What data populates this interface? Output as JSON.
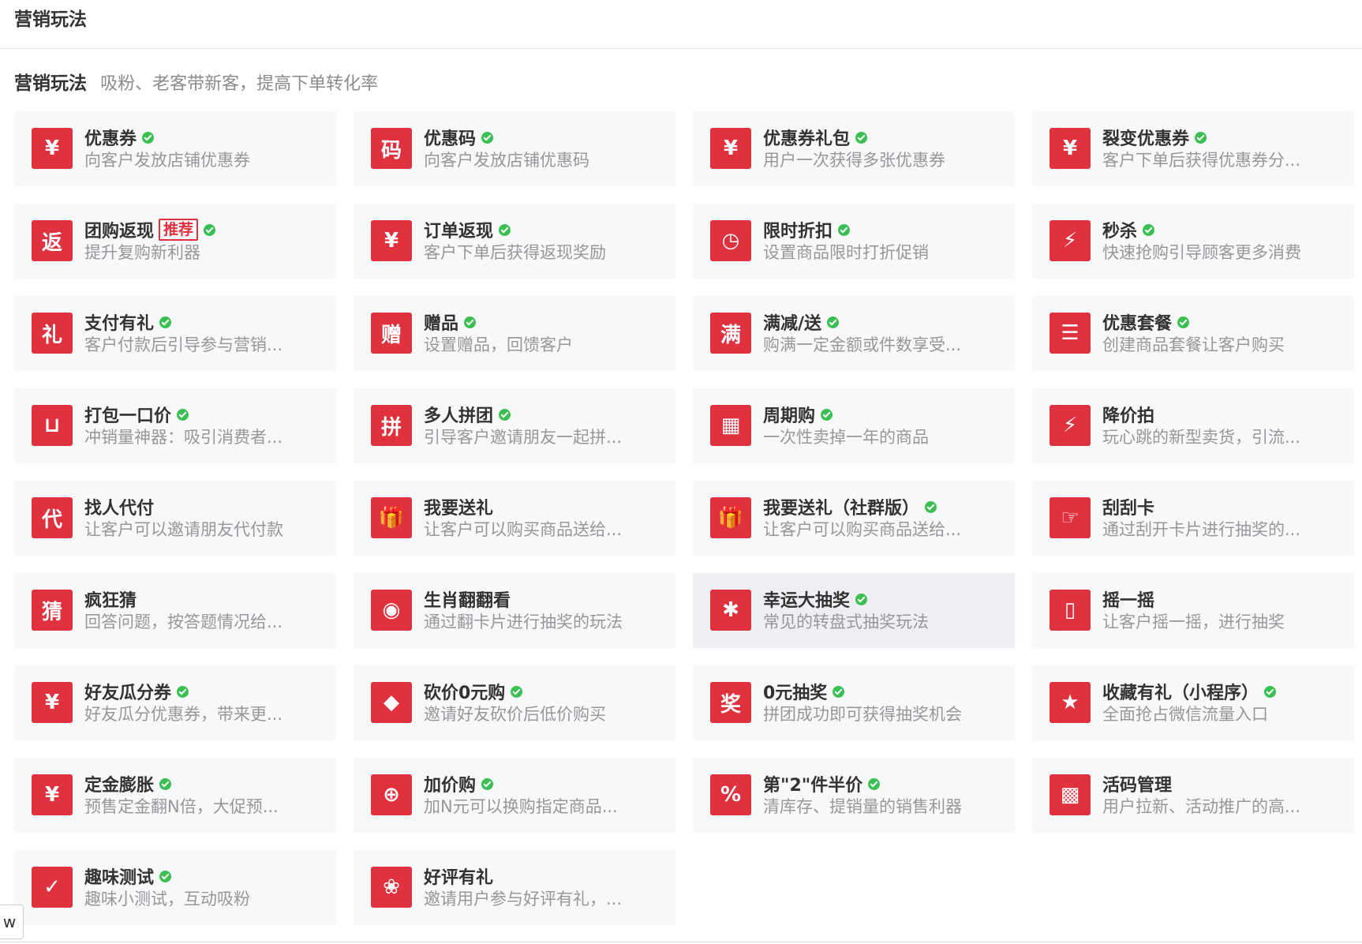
{
  "header": {
    "title": "营销玩法"
  },
  "section": {
    "title": "营销玩法",
    "desc": "吸粉、老客带新客，提高下单转化率"
  },
  "corner": {
    "label": "w"
  },
  "tools": [
    {
      "name": "优惠券",
      "desc": "向客户发放店铺优惠券",
      "icon": "coupon-icon",
      "glyph": "¥",
      "check": true
    },
    {
      "name": "优惠码",
      "desc": "向客户发放店铺优惠码",
      "icon": "code-icon",
      "glyph": "码",
      "check": true
    },
    {
      "name": "优惠券礼包",
      "desc": "用户一次获得多张优惠券",
      "icon": "coupon-pack-icon",
      "glyph": "¥",
      "check": true
    },
    {
      "name": "裂变优惠券",
      "desc": "客户下单后获得优惠券分...",
      "icon": "split-coupon-icon",
      "glyph": "¥",
      "check": true
    },
    {
      "name": "团购返现",
      "desc": "提升复购新利器",
      "icon": "cashback-icon",
      "glyph": "返",
      "check": true,
      "badge": "推荐"
    },
    {
      "name": "订单返现",
      "desc": "客户下单后获得返现奖励",
      "icon": "money-bag-icon",
      "glyph": "¥",
      "check": true
    },
    {
      "name": "限时折扣",
      "desc": "设置商品限时打折促销",
      "icon": "clock-icon",
      "glyph": "◷",
      "check": true
    },
    {
      "name": "秒杀",
      "desc": "快速抢购引导顾客更多消费",
      "icon": "lightning-icon",
      "glyph": "⚡",
      "check": true
    },
    {
      "name": "支付有礼",
      "desc": "客户付款后引导参与营销...",
      "icon": "pay-gift-icon",
      "glyph": "礼",
      "check": true
    },
    {
      "name": "赠品",
      "desc": "设置赠品，回馈客户",
      "icon": "gift-text-icon",
      "glyph": "赠",
      "check": true
    },
    {
      "name": "满减/送",
      "desc": "购满一定金额或件数享受...",
      "icon": "full-reduce-icon",
      "glyph": "满",
      "check": true
    },
    {
      "name": "优惠套餐",
      "desc": "创建商品套餐让客户购买",
      "icon": "list-icon",
      "glyph": "☰",
      "check": true
    },
    {
      "name": "打包一口价",
      "desc": "冲销量神器：吸引消费者...",
      "icon": "basket-icon",
      "glyph": "⊔",
      "check": true
    },
    {
      "name": "多人拼团",
      "desc": "引导客户邀请朋友一起拼...",
      "icon": "group-buy-icon",
      "glyph": "拼",
      "check": true
    },
    {
      "name": "周期购",
      "desc": "一次性卖掉一年的商品",
      "icon": "calendar-icon",
      "glyph": "▦",
      "check": true
    },
    {
      "name": "降价拍",
      "desc": "玩心跳的新型卖货，引流...",
      "icon": "bolt-icon",
      "glyph": "⚡",
      "check": false
    },
    {
      "name": "找人代付",
      "desc": "让客户可以邀请朋友代付款",
      "icon": "proxy-pay-icon",
      "glyph": "代",
      "check": false
    },
    {
      "name": "我要送礼",
      "desc": "让客户可以购买商品送给...",
      "icon": "present-icon",
      "glyph": "🎁",
      "check": false
    },
    {
      "name": "我要送礼（社群版）",
      "desc": "让客户可以购买商品送给...",
      "icon": "community-gift-icon",
      "glyph": "🎁",
      "check": true
    },
    {
      "name": "刮刮卡",
      "desc": "通过刮开卡片进行抽奖的...",
      "icon": "scratch-card-icon",
      "glyph": "☞",
      "check": false
    },
    {
      "name": "疯狂猜",
      "desc": "回答问题，按答题情况给...",
      "icon": "guess-icon",
      "glyph": "猜",
      "check": false
    },
    {
      "name": "生肖翻翻看",
      "desc": "通过翻卡片进行抽奖的玩法",
      "icon": "zodiac-icon",
      "glyph": "◉",
      "check": false
    },
    {
      "name": "幸运大抽奖",
      "desc": "常见的转盘式抽奖玩法",
      "icon": "wheel-icon",
      "glyph": "✱",
      "check": true,
      "hover": true
    },
    {
      "name": "摇一摇",
      "desc": "让客户摇一摇，进行抽奖",
      "icon": "shake-phone-icon",
      "glyph": "▯",
      "check": false
    },
    {
      "name": "好友瓜分券",
      "desc": "好友瓜分优惠券，带来更...",
      "icon": "share-coupon-icon",
      "glyph": "¥",
      "check": true
    },
    {
      "name": "砍价0元购",
      "desc": "邀请好友砍价后低价购买",
      "icon": "tag-icon",
      "glyph": "◆",
      "check": true
    },
    {
      "name": "0元抽奖",
      "desc": "拼团成功即可获得抽奖机会",
      "icon": "prize-icon",
      "glyph": "奖",
      "check": true
    },
    {
      "name": "收藏有礼（小程序）",
      "desc": "全面抢占微信流量入口",
      "icon": "star-icon",
      "glyph": "★",
      "check": true
    },
    {
      "name": "定金膨胀",
      "desc": "预售定金翻N倍，大促预...",
      "icon": "deposit-icon",
      "glyph": "¥",
      "check": true
    },
    {
      "name": "加价购",
      "desc": "加N元可以换购指定商品...",
      "icon": "add-price-icon",
      "glyph": "⊕",
      "check": true
    },
    {
      "name": "第\"2\"件半价",
      "desc": "清库存、提销量的销售利器",
      "icon": "percent-icon",
      "glyph": "%",
      "check": true
    },
    {
      "name": "活码管理",
      "desc": "用户拉新、活动推广的高...",
      "icon": "qr-code-icon",
      "glyph": "▩",
      "check": false
    },
    {
      "name": "趣味测试",
      "desc": "趣味小测试，互动吸粉",
      "icon": "quiz-icon",
      "glyph": "✓",
      "check": true
    },
    {
      "name": "好评有礼",
      "desc": "邀请用户参与好评有礼，...",
      "icon": "flower-icon",
      "glyph": "❀",
      "check": false
    }
  ]
}
